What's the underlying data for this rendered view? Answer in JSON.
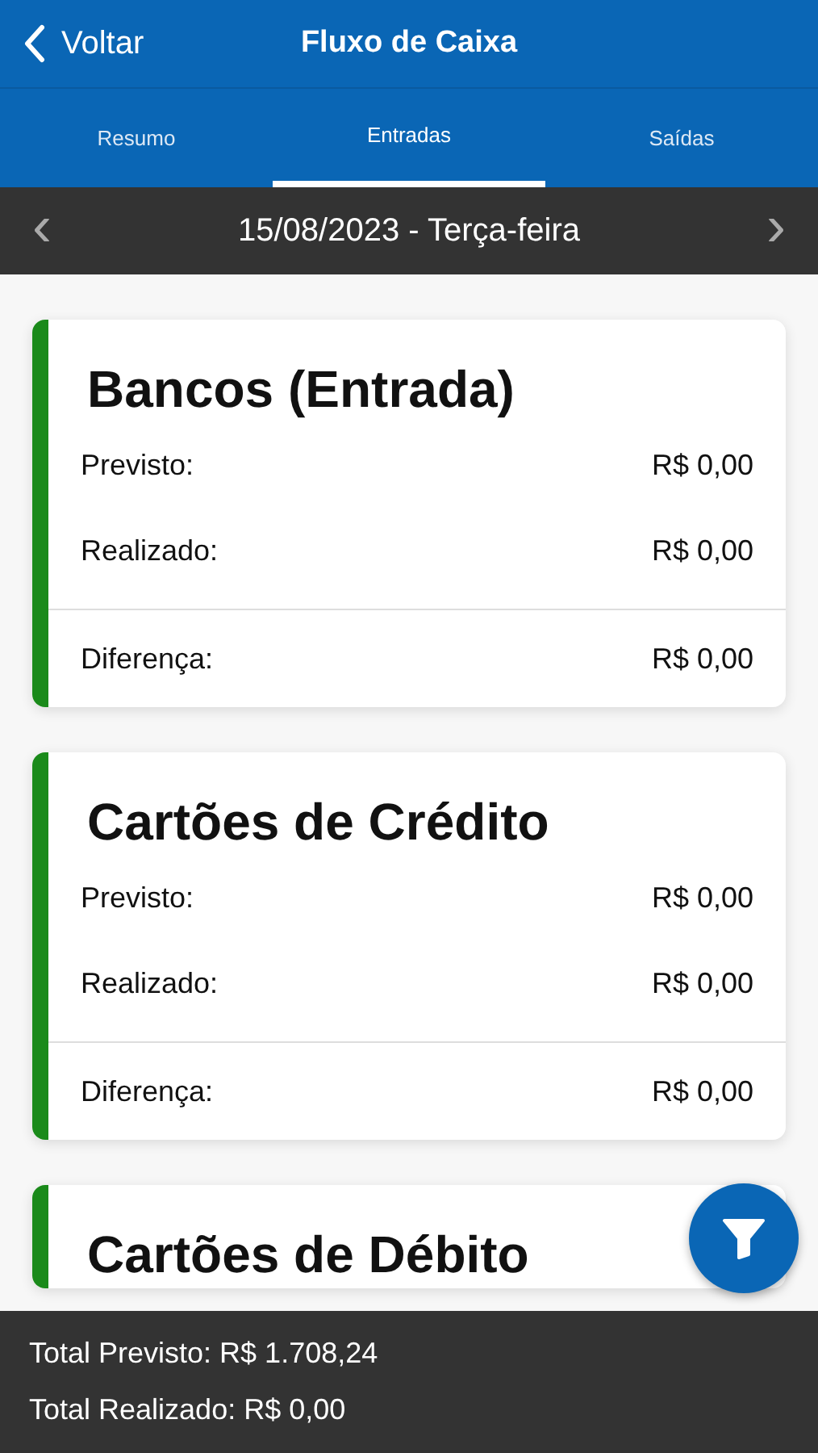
{
  "header": {
    "back_label": "Voltar",
    "title": "Fluxo de Caixa"
  },
  "tabs": [
    {
      "label": "Resumo",
      "selected": false
    },
    {
      "label": "Entradas",
      "selected": true
    },
    {
      "label": "Saídas",
      "selected": false
    }
  ],
  "date_bar": {
    "prev": "‹",
    "date": "15/08/2023 - Terça-feira",
    "next": "›"
  },
  "cards": [
    {
      "title": "Bancos (Entrada)",
      "color": "#1a8a1a",
      "rows": [
        {
          "label": "Previsto:",
          "value": "R$ 0,00"
        },
        {
          "label": "Realizado:",
          "value": "R$ 0,00"
        }
      ],
      "diff": {
        "label": "Diferença:",
        "value": "R$ 0,00"
      }
    },
    {
      "title": "Cartões de Crédito",
      "color": "#1a8a1a",
      "rows": [
        {
          "label": "Previsto:",
          "value": "R$ 0,00"
        },
        {
          "label": "Realizado:",
          "value": "R$ 0,00"
        }
      ],
      "diff": {
        "label": "Diferença:",
        "value": "R$ 0,00"
      }
    },
    {
      "title": "Cartões de Débito",
      "color": "#1a8a1a"
    }
  ],
  "totals": [
    "Total Previsto: R$ 1.708,24",
    "Total Realizado: R$ 0,00"
  ]
}
